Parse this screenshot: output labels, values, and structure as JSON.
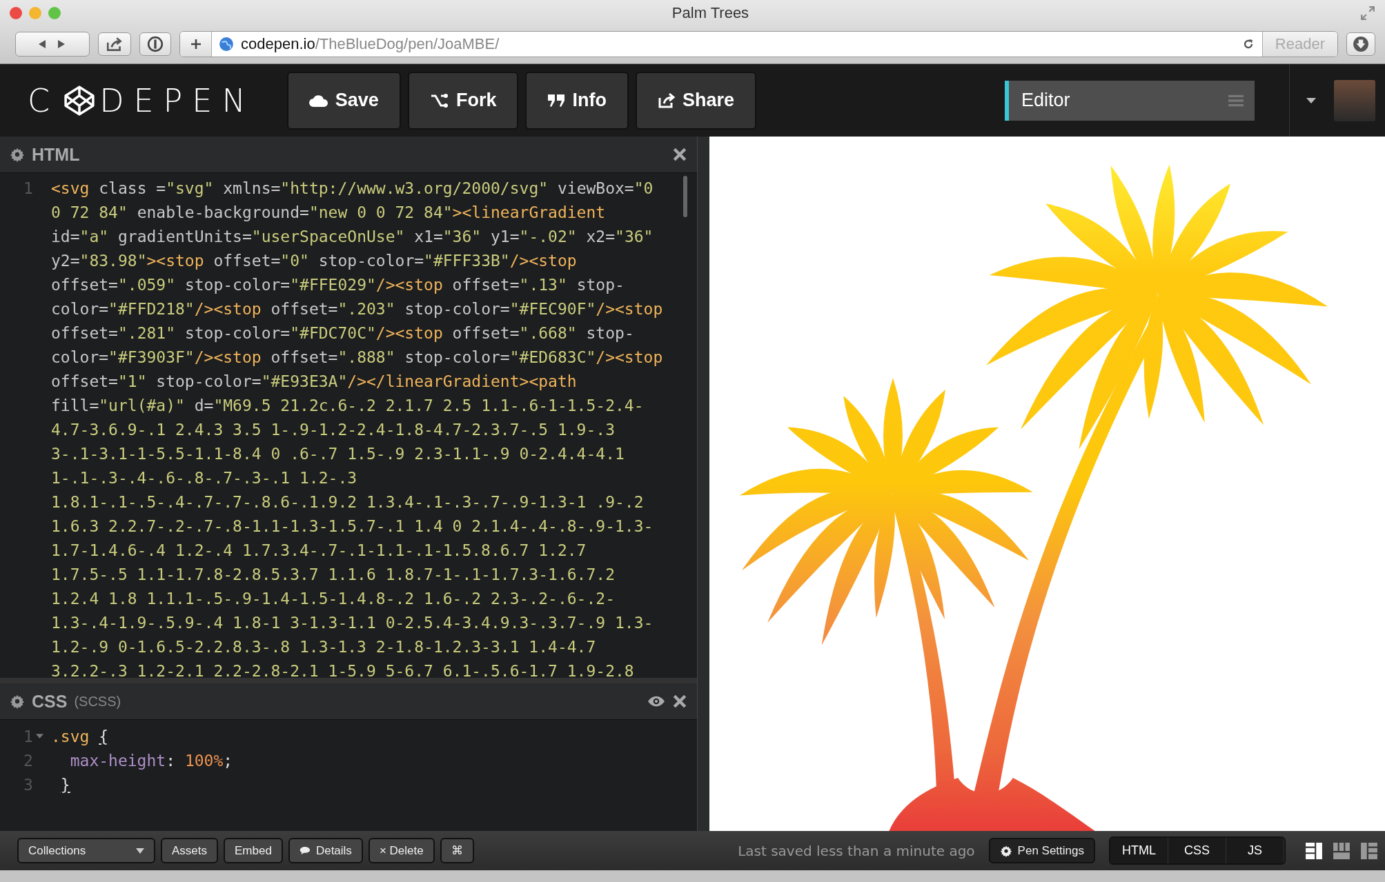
{
  "browser": {
    "title": "Palm Trees",
    "url_host": "codepen.io",
    "url_path": "/TheBlueDog/pen/JoaMBE/",
    "reader": "Reader"
  },
  "header": {
    "logo_start": "C",
    "logo_end": "DEPEN",
    "buttons": [
      {
        "label": "Save"
      },
      {
        "label": "Fork"
      },
      {
        "label": "Info"
      },
      {
        "label": "Share"
      }
    ],
    "view": "Editor"
  },
  "html_panel": {
    "title": "HTML",
    "rows": [
      {
        "number": "1",
        "segments": [
          {
            "kind": "tag",
            "text": "<svg"
          },
          {
            "kind": "attr",
            "text": " class ="
          },
          {
            "kind": "str",
            "text": "\"svg\""
          },
          {
            "kind": "attr",
            "text": " xmlns="
          },
          {
            "kind": "str",
            "text": "\"http://www.w3.org/2000/svg\""
          },
          {
            "kind": "attr",
            "text": " viewBox="
          },
          {
            "kind": "str",
            "text": "\"0"
          }
        ]
      },
      {
        "segments": [
          {
            "kind": "str",
            "text": "0 72 84\""
          },
          {
            "kind": "attr",
            "text": " enable-background="
          },
          {
            "kind": "str",
            "text": "\"new 0 0 72 84\""
          },
          {
            "kind": "tag",
            "text": "><linearGradient"
          }
        ]
      },
      {
        "segments": [
          {
            "kind": "attr",
            "text": "id="
          },
          {
            "kind": "str",
            "text": "\"a\""
          },
          {
            "kind": "attr",
            "text": " gradientUnits="
          },
          {
            "kind": "str",
            "text": "\"userSpaceOnUse\""
          },
          {
            "kind": "attr",
            "text": " x1="
          },
          {
            "kind": "str",
            "text": "\"36\""
          },
          {
            "kind": "attr",
            "text": " y1="
          },
          {
            "kind": "str",
            "text": "\"-.02\""
          },
          {
            "kind": "attr",
            "text": " x2="
          },
          {
            "kind": "str",
            "text": "\"36\""
          }
        ]
      },
      {
        "segments": [
          {
            "kind": "attr",
            "text": "y2="
          },
          {
            "kind": "str",
            "text": "\"83.98\""
          },
          {
            "kind": "tag",
            "text": "><stop"
          },
          {
            "kind": "attr",
            "text": " offset="
          },
          {
            "kind": "str",
            "text": "\"0\""
          },
          {
            "kind": "attr",
            "text": " stop-color="
          },
          {
            "kind": "str",
            "text": "\"#FFF33B\""
          },
          {
            "kind": "tag",
            "text": "/><stop"
          }
        ]
      },
      {
        "segments": [
          {
            "kind": "attr",
            "text": "offset="
          },
          {
            "kind": "str",
            "text": "\".059\""
          },
          {
            "kind": "attr",
            "text": " stop-color="
          },
          {
            "kind": "str",
            "text": "\"#FFE029\""
          },
          {
            "kind": "tag",
            "text": "/><stop"
          },
          {
            "kind": "attr",
            "text": " offset="
          },
          {
            "kind": "str",
            "text": "\".13\""
          },
          {
            "kind": "attr",
            "text": " stop-"
          }
        ]
      },
      {
        "segments": [
          {
            "kind": "attr",
            "text": "color="
          },
          {
            "kind": "str",
            "text": "\"#FFD218\""
          },
          {
            "kind": "tag",
            "text": "/><stop"
          },
          {
            "kind": "attr",
            "text": " offset="
          },
          {
            "kind": "str",
            "text": "\".203\""
          },
          {
            "kind": "attr",
            "text": " stop-color="
          },
          {
            "kind": "str",
            "text": "\"#FEC90F\""
          },
          {
            "kind": "tag",
            "text": "/><stop"
          }
        ]
      },
      {
        "segments": [
          {
            "kind": "attr",
            "text": "offset="
          },
          {
            "kind": "str",
            "text": "\".281\""
          },
          {
            "kind": "attr",
            "text": " stop-color="
          },
          {
            "kind": "str",
            "text": "\"#FDC70C\""
          },
          {
            "kind": "tag",
            "text": "/><stop"
          },
          {
            "kind": "attr",
            "text": " offset="
          },
          {
            "kind": "str",
            "text": "\".668\""
          },
          {
            "kind": "attr",
            "text": " stop-"
          }
        ]
      },
      {
        "segments": [
          {
            "kind": "attr",
            "text": "color="
          },
          {
            "kind": "str",
            "text": "\"#F3903F\""
          },
          {
            "kind": "tag",
            "text": "/><stop"
          },
          {
            "kind": "attr",
            "text": " offset="
          },
          {
            "kind": "str",
            "text": "\".888\""
          },
          {
            "kind": "attr",
            "text": " stop-color="
          },
          {
            "kind": "str",
            "text": "\"#ED683C\""
          },
          {
            "kind": "tag",
            "text": "/><stop"
          }
        ]
      },
      {
        "segments": [
          {
            "kind": "attr",
            "text": "offset="
          },
          {
            "kind": "str",
            "text": "\"1\""
          },
          {
            "kind": "attr",
            "text": " stop-color="
          },
          {
            "kind": "str",
            "text": "\"#E93E3A\""
          },
          {
            "kind": "tag",
            "text": "/></linearGradient><path"
          }
        ]
      },
      {
        "segments": [
          {
            "kind": "attr",
            "text": "fill="
          },
          {
            "kind": "str",
            "text": "\"url(#a)\""
          },
          {
            "kind": "attr",
            "text": " d="
          },
          {
            "kind": "str",
            "text": "\"M69.5 21.2c.6-.2 2.1.7 2.5 1.1-.6-1-1.5-2.4-"
          }
        ]
      },
      {
        "segments": [
          {
            "kind": "str",
            "text": "4.7-3.6.9-.1 2.4.3 3.5 1-.9-1.2-2.4-1.8-4.7-2.3.7-.5 1.9-.3"
          }
        ]
      },
      {
        "segments": [
          {
            "kind": "str",
            "text": "3-.1-3.1-1-5.5-1.1-8.4 0 .6-.7 1.5-.9 2.3-1.1-.9 0-2.4.4-4.1"
          }
        ]
      },
      {
        "segments": [
          {
            "kind": "str",
            "text": "1-.1-.3-.4-.6-.8-.7-.3-.1 1.2-.3"
          }
        ]
      },
      {
        "segments": [
          {
            "kind": "str",
            "text": "1.8.1-.1-.5-.4-.7-.7-.8.6-.1.9.2 1.3.4-.1-.3-.7-.9-1.3-1 .9-.2"
          }
        ]
      },
      {
        "segments": [
          {
            "kind": "str",
            "text": "1.6.3 2.2.7-.2-.7-.8-1.1-1.3-1.5.7-.1 1.4 0 2.1.4-.4-.8-.9-1.3-"
          }
        ]
      },
      {
        "segments": [
          {
            "kind": "str",
            "text": "1.7-1.4.6-.4 1.2-.4 1.7.3.4-.7-.1-1.1-.1-1.5.8.6.7 1.2.7"
          }
        ]
      },
      {
        "segments": [
          {
            "kind": "str",
            "text": "1.7.5-.5 1.1-1.7.8-2.8.5.3.7 1.1.6 1.8.7-1-.1-1.7.3-1.6.7.2"
          }
        ]
      },
      {
        "segments": [
          {
            "kind": "str",
            "text": "1.2.4 1.8 1.1.1-.5-.9-1.4-1.5-1.4.8-.2 1.6-.2 2.3-.2-.6-.2-"
          }
        ]
      },
      {
        "segments": [
          {
            "kind": "str",
            "text": "1.3-.4-1.9-.5.9-.4 1.8-1 3-1.3-1.1 0-2.5.4-3.4.9.3-.3.7-.9 1.3-"
          }
        ]
      },
      {
        "segments": [
          {
            "kind": "str",
            "text": "1.2-.9 0-1.6.5-2.2.8.3-.8 1.3-1.3 2-1.8-1.2.3-3.1 1.4-4.7"
          }
        ]
      },
      {
        "segments": [
          {
            "kind": "str",
            "text": "3.2.2-.3 1.2-2.1 2.2-2.8-2.1 1-5.9 5-6.7 6.1-.5.6-1.7 1.9-2.8"
          }
        ]
      }
    ]
  },
  "css_panel": {
    "title": "CSS",
    "subtitle": "(SCSS)",
    "rows": [
      {
        "number": "1",
        "fold_marker": true,
        "segments": [
          {
            "kind": "selector",
            "text": ".svg"
          },
          {
            "kind": "brace",
            "text": "{"
          }
        ]
      },
      {
        "number": "2",
        "fold_marker": false,
        "segments": [
          {
            "kind": "prop",
            "text": "max-height"
          },
          {
            "kind": "plain",
            "text": ":"
          },
          {
            "kind": "value",
            "text": "100%"
          },
          {
            "kind": "plain",
            "text": ";"
          }
        ]
      },
      {
        "number": "3",
        "fold_marker": false,
        "segments": [
          {
            "kind": "brace",
            "text": "}"
          }
        ]
      }
    ]
  },
  "footer": {
    "collections": "Collections",
    "buttons": [
      {
        "label": "Assets"
      },
      {
        "label": "Embed"
      },
      {
        "label": "Details"
      },
      {
        "label": "× Delete"
      },
      {
        "label": "⌘"
      }
    ],
    "status": "Last saved less than a minute ago",
    "pen_settings": "Pen Settings",
    "toggles": [
      "HTML",
      "CSS",
      "JS"
    ]
  }
}
